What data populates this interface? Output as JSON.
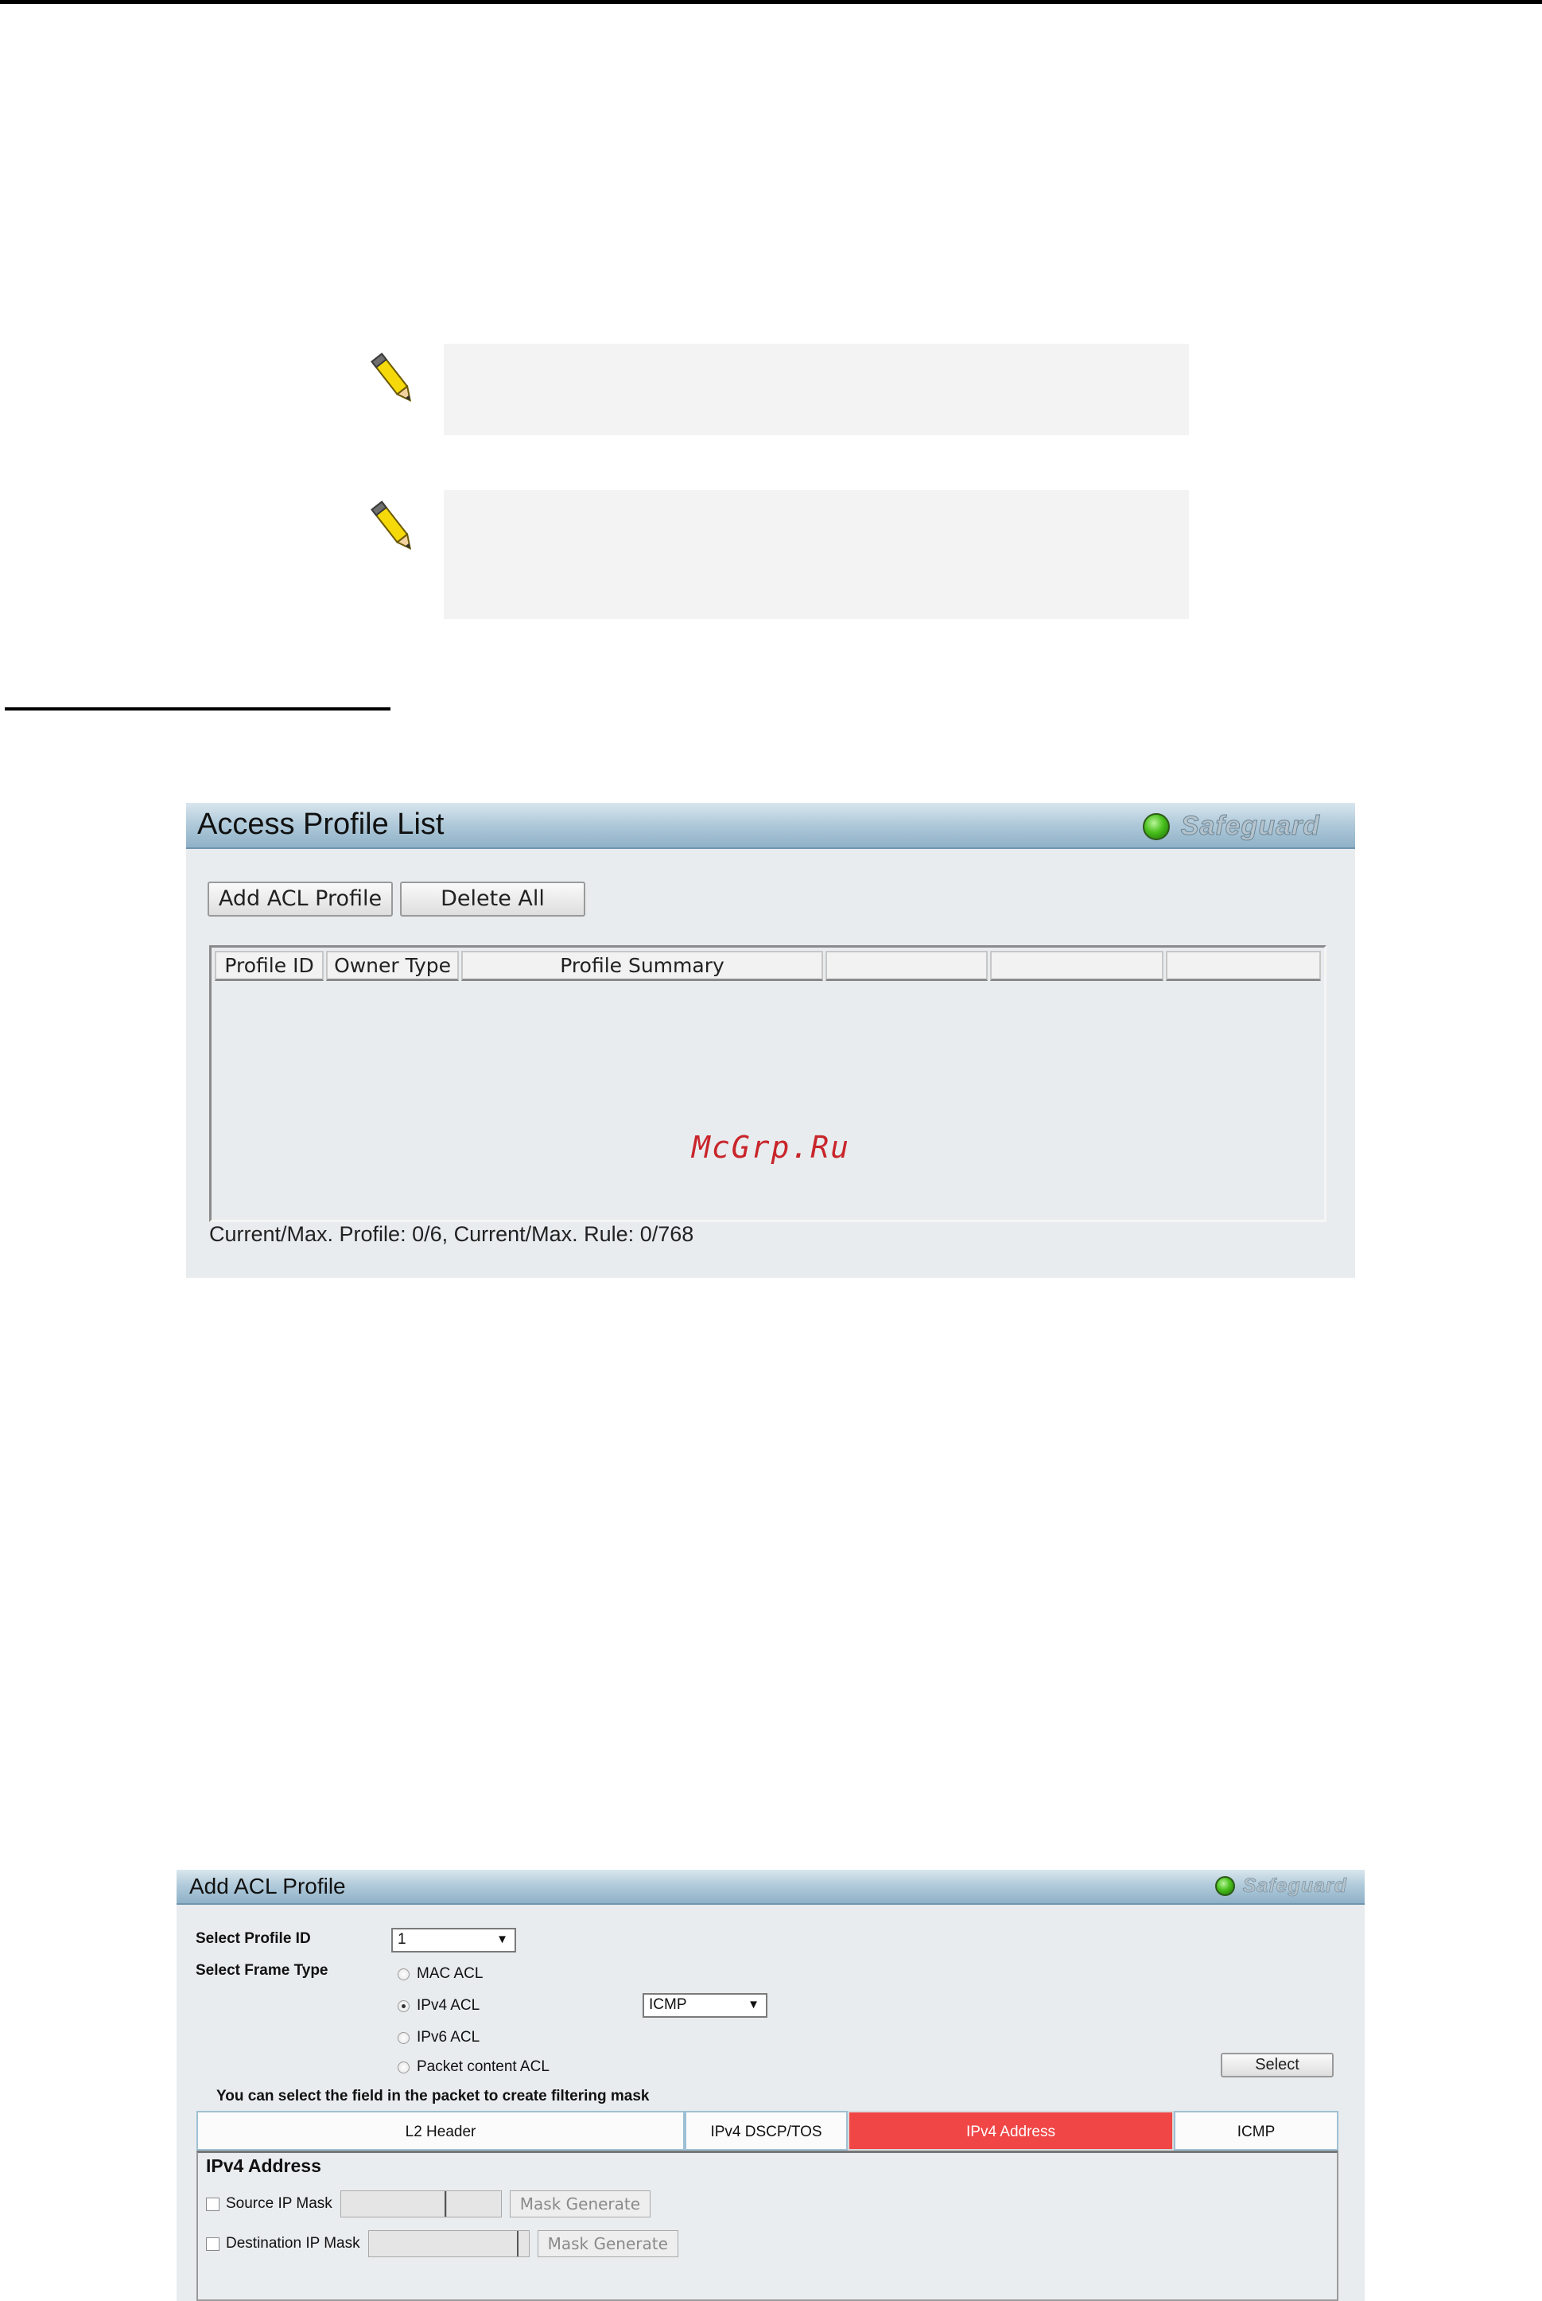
{
  "access_profile_list": {
    "title": "Access Profile List",
    "safeguard_label": "Safeguard",
    "add_button": "Add ACL Profile",
    "delete_all_button": "Delete All",
    "columns": [
      "Profile ID",
      "Owner Type",
      "Profile Summary",
      "",
      "",
      ""
    ],
    "watermark": "McGrp.Ru",
    "status": "Current/Max. Profile: 0/6, Current/Max. Rule: 0/768"
  },
  "add_acl_profile": {
    "title": "Add ACL Profile",
    "safeguard_label": "Safeguard",
    "profile_id_label": "Select Profile ID",
    "profile_id_value": "1",
    "frame_type_label": "Select Frame Type",
    "frame_types": [
      {
        "label": "MAC ACL",
        "selected": false
      },
      {
        "label": "IPv4 ACL",
        "selected": true
      },
      {
        "label": "IPv6 ACL",
        "selected": false
      },
      {
        "label": "Packet content ACL",
        "selected": false
      }
    ],
    "ipv4_protocol_value": "ICMP",
    "select_button": "Select",
    "hint": "You can select the field in the packet to create filtering mask",
    "tabs": [
      {
        "label": "L2 Header",
        "active": false
      },
      {
        "label": "IPv4 DSCP/TOS",
        "active": false
      },
      {
        "label": "IPv4 Address",
        "active": true
      },
      {
        "label": "ICMP",
        "active": false
      }
    ],
    "section_title": "IPv4 Address",
    "source_ip_mask_label": "Source IP Mask",
    "destination_ip_mask_label": "Destination IP Mask",
    "mask_generate_label": "Mask Generate"
  },
  "colors": {
    "active_tab": "#f04646",
    "panel_bg": "#e8ecee",
    "safeguard_green": "#49c01c",
    "watermark_red": "#c8252b"
  }
}
